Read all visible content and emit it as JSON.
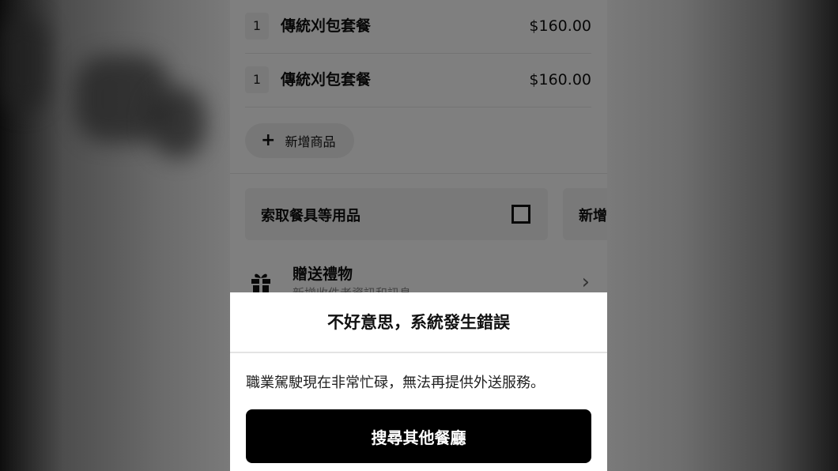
{
  "order": {
    "items": [
      {
        "qty": "1",
        "name": "傳統刈包套餐",
        "price": "$160.00"
      },
      {
        "qty": "1",
        "name": "傳統刈包套餐",
        "price": "$160.00"
      }
    ],
    "add_item_label": "新增商品"
  },
  "options": {
    "cutlery_label": "索取餐具等用品",
    "cutlery_checked": false,
    "next_card_label": "新增"
  },
  "gift": {
    "title": "贈送禮物",
    "subtitle": "新增收件者資訊和訊息"
  },
  "dialog": {
    "title": "不好意思，系統發生錯誤",
    "message": "職業駕駛現在非常忙碌，無法再提供外送服務。",
    "button_label": "搜尋其他餐廳"
  },
  "icons": [
    "plus-icon",
    "checkbox-icon",
    "gift-icon",
    "chevron-right-icon"
  ]
}
